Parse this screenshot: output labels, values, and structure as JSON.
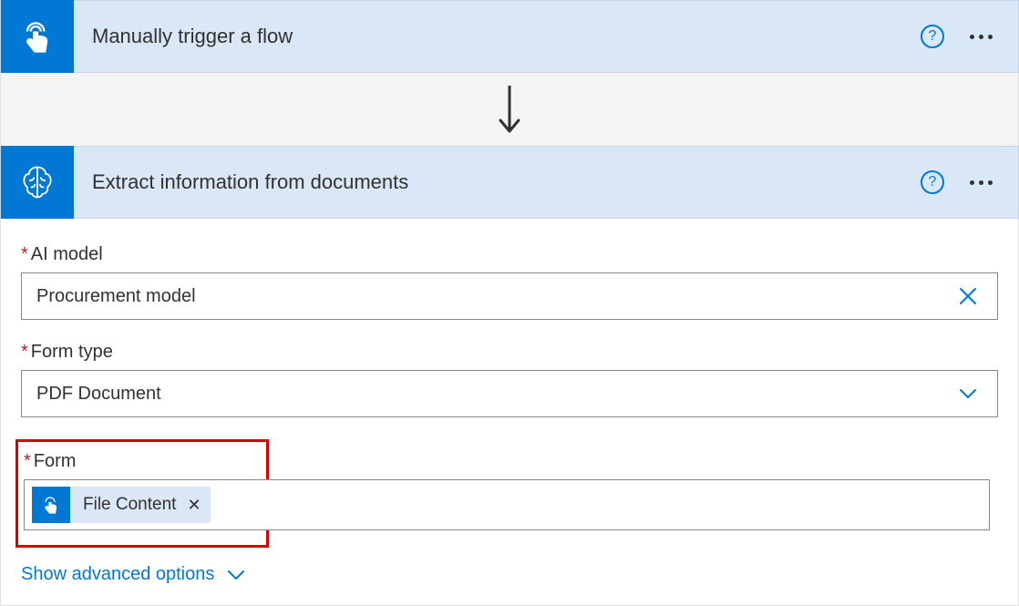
{
  "trigger": {
    "title": "Manually trigger a flow",
    "icon": "touch-icon"
  },
  "action": {
    "title": "Extract information from documents",
    "icon": "brain-icon",
    "fields": {
      "ai_model": {
        "label": "AI model",
        "required": true,
        "value": "Procurement model"
      },
      "form_type": {
        "label": "Form type",
        "required": true,
        "value": "PDF Document"
      },
      "form": {
        "label": "Form",
        "required": true,
        "token": {
          "label": "File Content",
          "icon": "touch-icon"
        }
      }
    },
    "advanced_toggle": "Show advanced options"
  }
}
